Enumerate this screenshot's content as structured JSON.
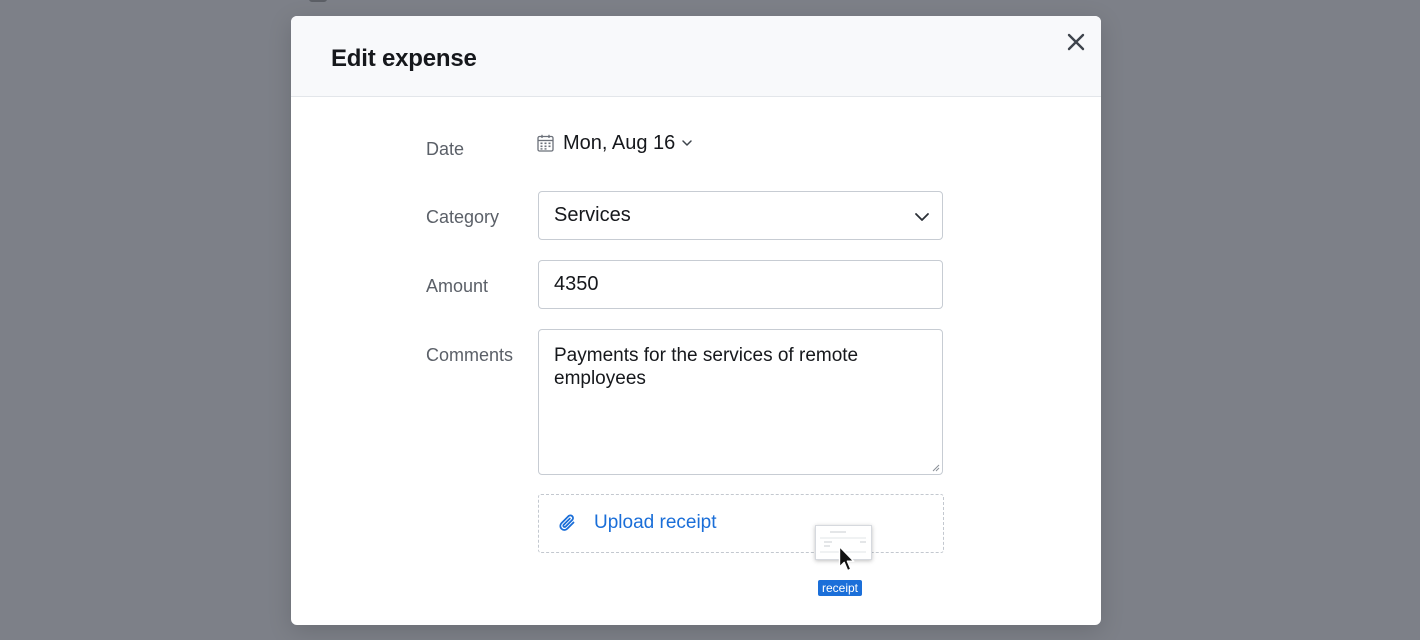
{
  "modal": {
    "title": "Edit expense"
  },
  "form": {
    "date": {
      "label": "Date",
      "value": "Mon, Aug 16"
    },
    "category": {
      "label": "Category",
      "value": "Services"
    },
    "amount": {
      "label": "Amount",
      "value": "4350"
    },
    "comments": {
      "label": "Comments",
      "value": "Payments for the services of remote employees"
    },
    "upload": {
      "label": "Upload receipt"
    }
  },
  "drag": {
    "file_label": "receipt"
  },
  "icons": {
    "close": "close-icon",
    "calendar": "calendar-icon",
    "chevron": "chevron-down-icon",
    "paperclip": "paperclip-icon",
    "cursor": "mouse-pointer-icon"
  },
  "colors": {
    "overlay": "#7d8088",
    "header_bg": "#f8f9fb",
    "accent": "#1a6ed8",
    "badge": "#1b6fd9"
  }
}
